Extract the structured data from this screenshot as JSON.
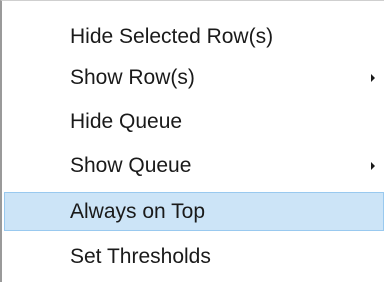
{
  "menu": {
    "items": [
      {
        "label": "Hide Selected Row(s)",
        "has_submenu": false,
        "highlighted": false
      },
      {
        "label": "Show Row(s)",
        "has_submenu": true,
        "highlighted": false
      },
      {
        "label": "Hide Queue",
        "has_submenu": false,
        "highlighted": false
      },
      {
        "label": "Show Queue",
        "has_submenu": true,
        "highlighted": false
      },
      {
        "label": "Always on Top",
        "has_submenu": false,
        "highlighted": true
      },
      {
        "label": "Set Thresholds",
        "has_submenu": false,
        "highlighted": false
      }
    ],
    "colors": {
      "highlight_background": "#cce4f7",
      "highlight_border": "#99c9ef",
      "text": "#1a1a1a"
    },
    "icons": {
      "submenu": "chevron-right-icon"
    }
  }
}
